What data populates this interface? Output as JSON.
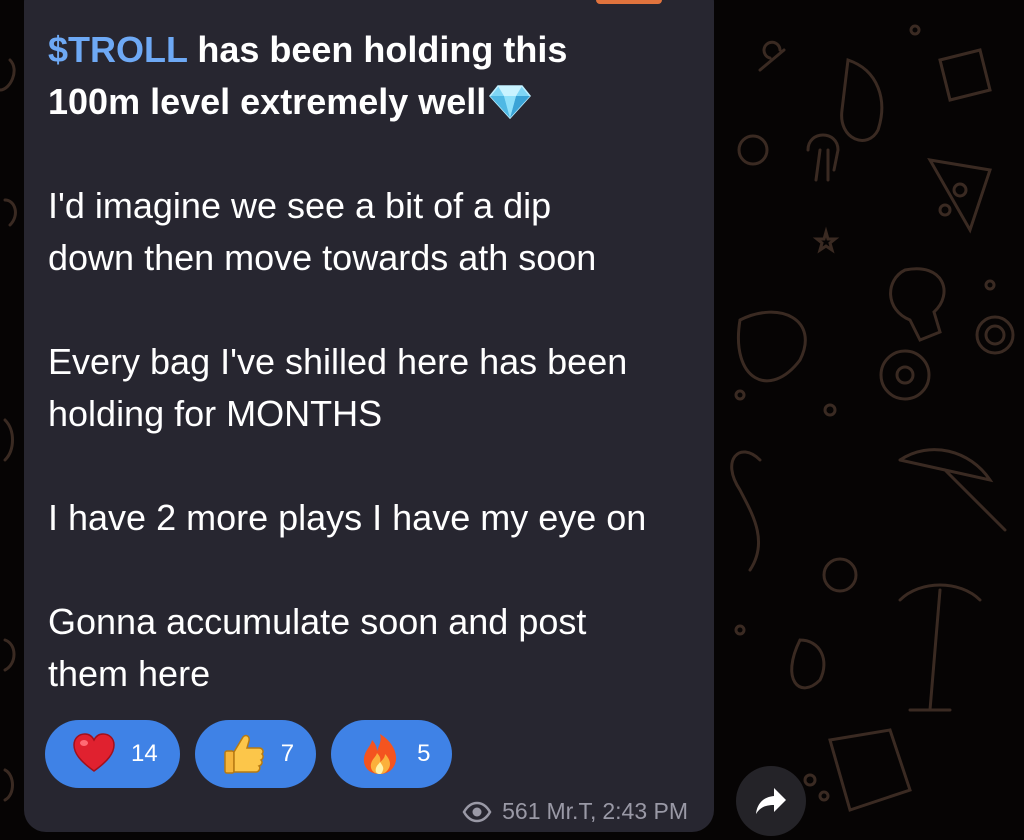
{
  "message": {
    "mention": "$TROLL",
    "headline_line1": " has been holding this",
    "headline_line2": "100m level extremely well",
    "headline_emoji": "gem-icon",
    "para2_line1": "I'd imagine we see a bit of a dip",
    "para2_line2": "down then move towards ath soon",
    "para3_line1": "Every bag I've shilled here has been",
    "para3_line2": "holding for MONTHS",
    "para4_line1": "I have 2 more plays I have my eye on",
    "para5_line1": "Gonna accumulate soon and post",
    "para5_line2": "them here"
  },
  "reactions": [
    {
      "icon": "heart-icon",
      "count": "14"
    },
    {
      "icon": "thumbs-up-icon",
      "count": "7"
    },
    {
      "icon": "fire-icon",
      "count": "5"
    }
  ],
  "meta": {
    "views": "561",
    "author": "Mr.T,",
    "time": "2:43 PM"
  },
  "colors": {
    "bubble": "#272630",
    "mention": "#6ea9f5",
    "reaction_bg": "#3f82e6",
    "meta_text": "#9a99a6",
    "accent": "#e1733d"
  }
}
